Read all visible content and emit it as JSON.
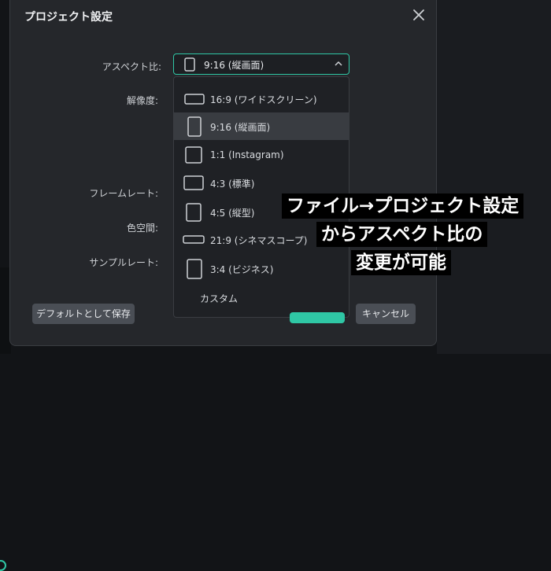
{
  "dialog": {
    "title": "プロジェクト設定",
    "close_label": "×"
  },
  "fields": {
    "aspect_label": "アスペクト比:",
    "resolution_label": "解像度:",
    "framerate_label": "フレームレート:",
    "colorspace_label": "色空間:",
    "samplerate_label": "サンプルレート:"
  },
  "aspect_select": {
    "value": "9:16 (縦画面)",
    "icon": "portrait-frame-icon",
    "expanded": true
  },
  "aspect_options": [
    {
      "label": "16:9 (ワイドスクリーン)",
      "icon": "landscape-frame-icon"
    },
    {
      "label": "9:16 (縦画面)",
      "icon": "portrait-frame-icon",
      "selected": true
    },
    {
      "label": "1:1 (Instagram)",
      "icon": "square-frame-icon"
    },
    {
      "label": "4:3 (標準)",
      "icon": "standard-frame-icon"
    },
    {
      "label": "4:5 (縦型)",
      "icon": "vertical-frame-icon"
    },
    {
      "label": "21:9 (シネマスコープ)",
      "icon": "cinemascope-frame-icon"
    },
    {
      "label": "3:4 (ビジネス)",
      "icon": "business-frame-icon"
    },
    {
      "label": "カスタム",
      "icon": ""
    }
  ],
  "buttons": {
    "default_label": "デフォルトとして保存",
    "cancel_label": "キャンセル"
  },
  "overlay": {
    "line1": "ファイル→プロジェクト設定",
    "line2": "からアスペクト比の",
    "line3": "変更が可能"
  },
  "colors": {
    "accent": "#2fc7a5",
    "dialog_bg": "#25272b",
    "selected_bg": "#393c41"
  }
}
